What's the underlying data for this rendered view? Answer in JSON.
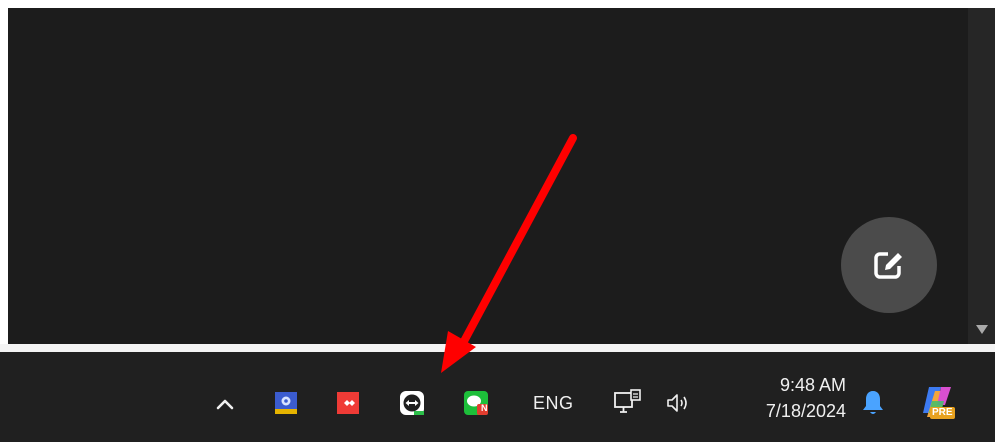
{
  "taskbar": {
    "language": "ENG",
    "time": "9:48 AM",
    "date": "7/18/2024",
    "copilot_badge": "PRE",
    "line_badge": "N"
  },
  "colors": {
    "window_bg": "#1c1c1c",
    "taskbar_bg": "#202020",
    "arrow": "#ff0000",
    "notification_bell": "#4aa3ff"
  }
}
